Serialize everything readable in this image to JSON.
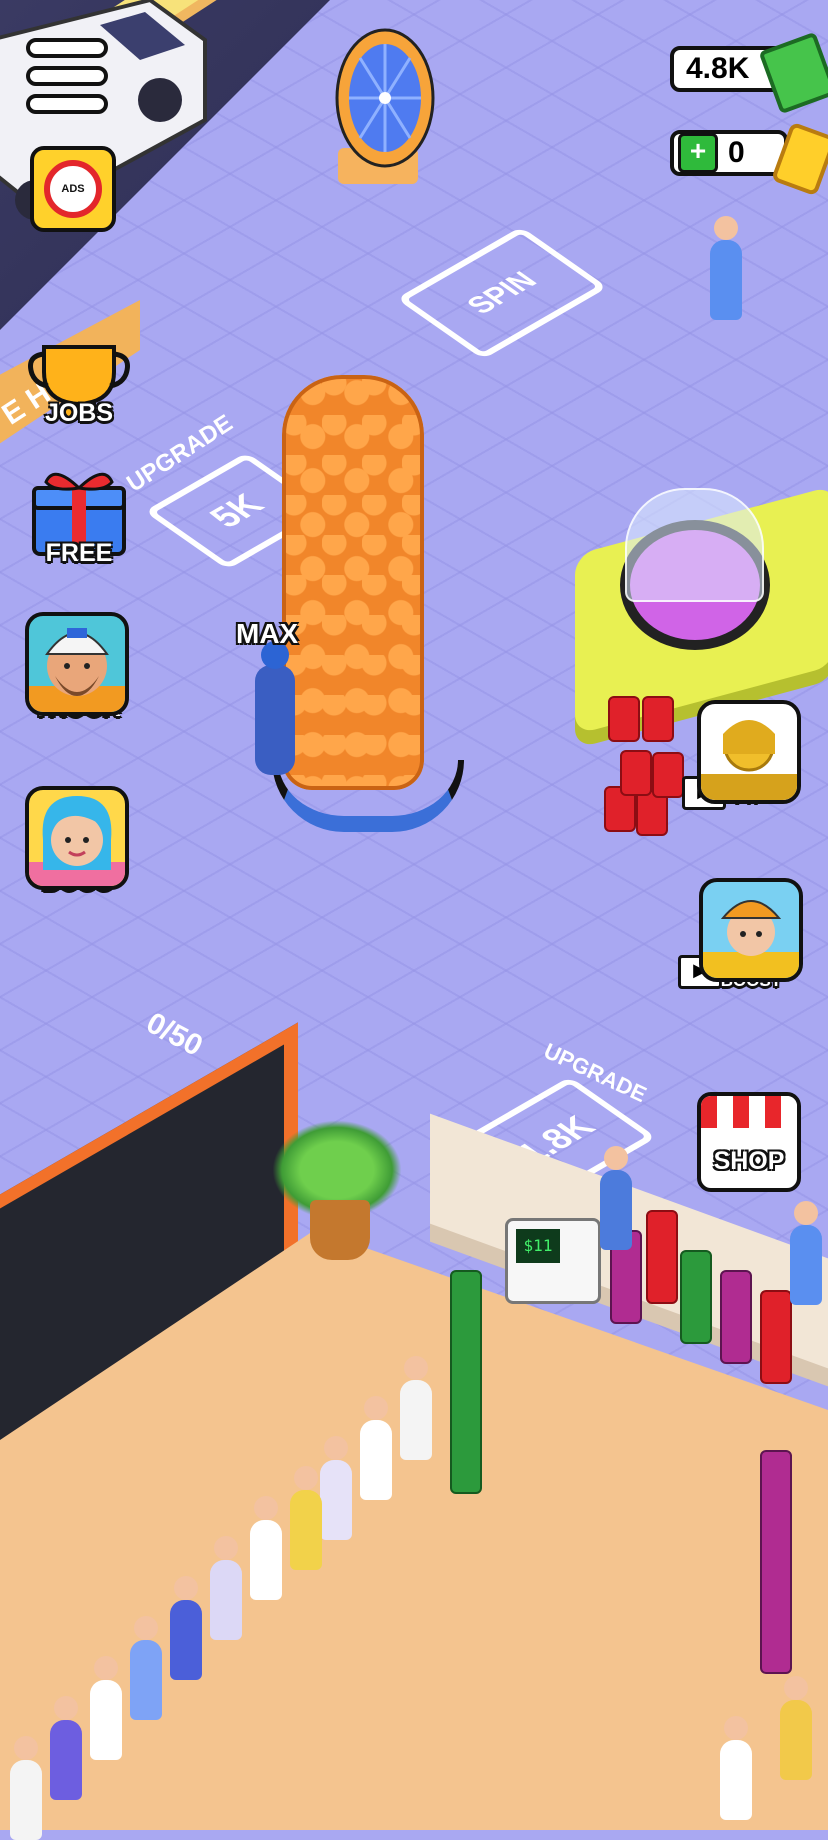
{
  "hud": {
    "menu_label": "",
    "cash": "4.8K",
    "tickets": "0"
  },
  "left_menu": [
    {
      "id": "jobs",
      "label": "JOBS"
    },
    {
      "id": "free",
      "label": "FREE"
    },
    {
      "id": "truck",
      "label": "TRUCK"
    },
    {
      "id": "boss",
      "label": "BOSS"
    }
  ],
  "right_menu": {
    "vip": "VIP",
    "machine_boost": "MACHINE BOOST",
    "shop": "SHOP"
  },
  "ads_button": {
    "text": "ADS"
  },
  "world": {
    "spin_pad": "SPIN",
    "upgrade_label_1": "UPGRADE",
    "upgrade_cost_1": "5K",
    "upgrade_label_2": "UPGRADE",
    "upgrade_cost_2": "1.8K",
    "stack_label": "MAX",
    "bin_counter": "0/50",
    "wall_text": "E HE",
    "register_display": "$11"
  },
  "colors": {
    "floor": "#a9a8f2",
    "cash_green": "#46c44b",
    "ticket_gold": "#ffcf2a",
    "shop_red": "#e8262b"
  }
}
